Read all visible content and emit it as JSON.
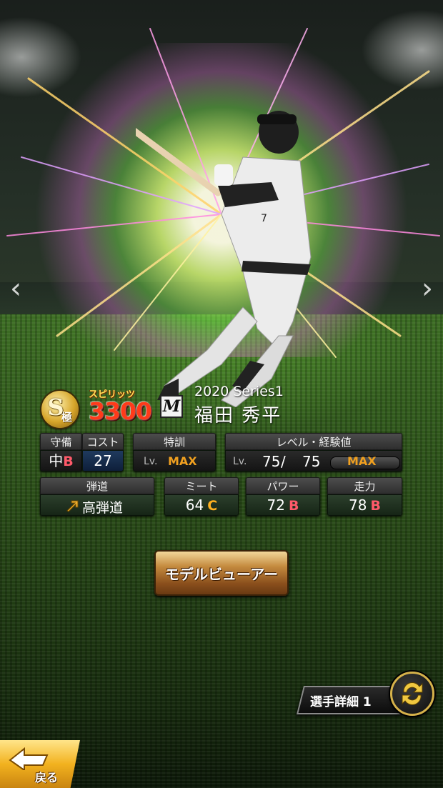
{
  "card": {
    "rank_letter": "S",
    "rank_sub": "極",
    "spirits_label": "スピリッツ",
    "spirits_value": "3300",
    "team_logo_letter": "M",
    "series": "2020 Series1",
    "player_name": "福田 秀平"
  },
  "stats": {
    "defense": {
      "header": "守備",
      "position": "中",
      "grade": "B"
    },
    "cost": {
      "header": "コスト",
      "value": "27"
    },
    "training": {
      "header": "特訓",
      "lv_prefix": "Lv.",
      "value": "MAX"
    },
    "level": {
      "header": "レベル・経験値",
      "lv_prefix": "Lv.",
      "current": "75",
      "separator": "/",
      "max": "75",
      "exp_label": "MAX"
    },
    "trajectory": {
      "header": "弾道",
      "value": "高弾道"
    },
    "contact": {
      "header": "ミート",
      "value": "64",
      "grade": "C"
    },
    "power": {
      "header": "パワー",
      "value": "72",
      "grade": "B"
    },
    "speed": {
      "header": "走力",
      "value": "78",
      "grade": "B"
    }
  },
  "buttons": {
    "model_viewer": "モデルビューアー",
    "player_detail": "選手詳細 1",
    "back": "戻る"
  },
  "nav": {
    "prev": "‹",
    "next": "›"
  },
  "icons": {
    "trajectory_arrow": "arrow-up-right-icon",
    "swap": "swap-arrows-icon",
    "back": "back-arrow-icon"
  },
  "colors": {
    "grade_b": "#ff5a6a",
    "grade_c": "#ffb020",
    "max": "#f0a020",
    "spirits": "#ff3a1a",
    "gold": "#d6b24a"
  }
}
